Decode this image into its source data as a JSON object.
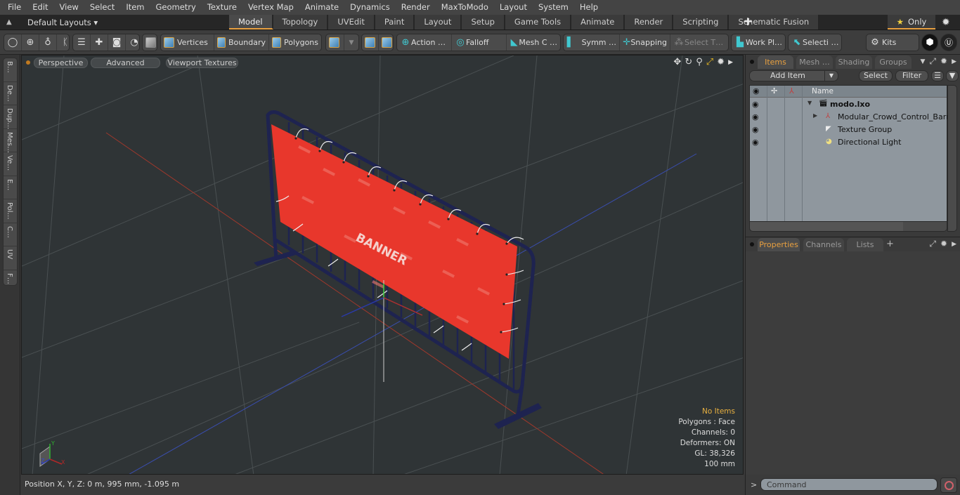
{
  "menu": [
    "File",
    "Edit",
    "View",
    "Select",
    "Item",
    "Geometry",
    "Texture",
    "Vertex Map",
    "Animate",
    "Dynamics",
    "Render",
    "MaxToModo",
    "Layout",
    "System",
    "Help"
  ],
  "layoutbar": {
    "layouts_label": "Default Layouts ▾",
    "tabs": [
      "Model",
      "Topology",
      "UVEdit",
      "Paint",
      "Layout",
      "Setup",
      "Game Tools",
      "Animate",
      "Render",
      "Scripting",
      "Schematic Fusion"
    ],
    "active_tab": "Model",
    "add_tab": "+",
    "only_label": "Only"
  },
  "toolbar": {
    "vertices": "Vertices",
    "boundary": "Boundary",
    "polygons": "Polygons",
    "action": "Action   …",
    "falloff": "Falloff",
    "mesh_c": "Mesh C …",
    "symm": "Symm …",
    "snapping": "Snapping",
    "select_t": "Select T…",
    "work_pl": "Work Pl…",
    "selecti": "Selecti …",
    "kits": "Kits"
  },
  "left_tabs": [
    "B…",
    "De…",
    "Dup…",
    "Mes…",
    "Ve…",
    "E…",
    "Pol…",
    "C…",
    "UV",
    "F…"
  ],
  "viewport": {
    "view_mode": "Perspective",
    "shading": "Advanced",
    "textures": "Viewport Textures",
    "banner_text": "BANNER",
    "info": {
      "selection": "No Items",
      "polygons": "Polygons : Face",
      "channels": "Channels: 0",
      "deformers": "Deformers: ON",
      "gl": "GL: 38,326",
      "grid": "100 mm"
    },
    "axis_labels": {
      "x": "X",
      "y": "Y",
      "z": "Z"
    }
  },
  "position": "Position X, Y, Z:   0 m, 995 mm, -1.095 m",
  "items_panel": {
    "tabs": [
      "Items",
      "Mesh …",
      "Shading",
      "Groups"
    ],
    "active_tab": "Items",
    "add_item": "Add Item",
    "select": "Select",
    "filter": "Filter",
    "name_header": "Name",
    "items": [
      {
        "label": "modo.lxo",
        "icon": "scene-icon",
        "level": 0,
        "expanded": true
      },
      {
        "label": "Modular_Crowd_Control_Barr…",
        "icon": "mesh-item-icon",
        "level": 1,
        "expanded": false
      },
      {
        "label": "Texture Group",
        "icon": "texture-group-icon",
        "level": 1
      },
      {
        "label": "Directional Light",
        "icon": "light-icon",
        "level": 1
      }
    ]
  },
  "properties_panel": {
    "tabs": [
      "Properties",
      "Channels",
      "Lists"
    ],
    "active_tab": "Properties",
    "add_tab": "+"
  },
  "command": {
    "prompt": ">",
    "placeholder": "Command"
  },
  "colors": {
    "accent": "#e8a040",
    "banner": "#e8372c",
    "barrier": "#1e2350",
    "viewport_bg": "#2f3436"
  }
}
